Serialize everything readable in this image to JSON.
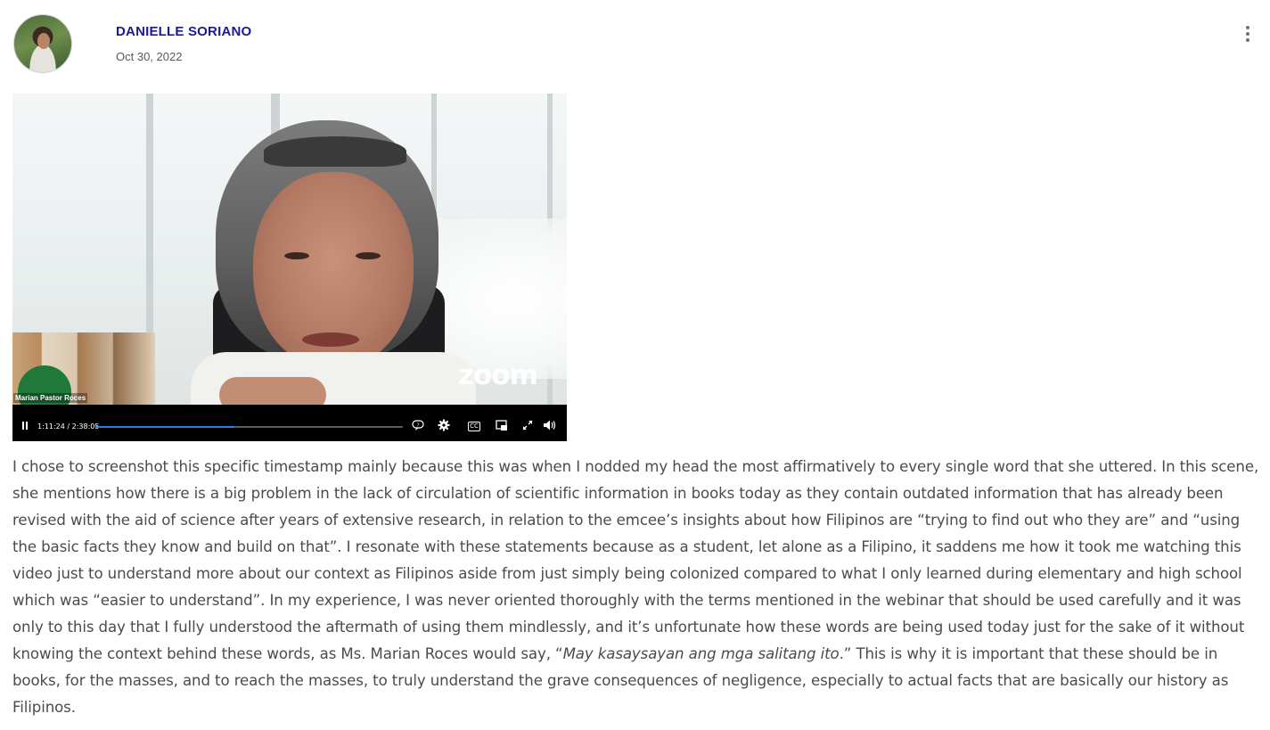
{
  "post": {
    "author": "DANIELLE SORIANO",
    "date": "Oct 30, 2022",
    "menu_icon": "more-vertical-icon"
  },
  "video": {
    "overlay_name": "Marian Pastor Roces",
    "watermark": "zoom",
    "time": "1:11:24 / 2:38:05",
    "progress_fraction": 0.451,
    "icons": [
      "pause-icon",
      "transcript-icon",
      "settings-icon",
      "closed-captions-icon",
      "picture-in-picture-icon",
      "fullscreen-icon",
      "volume-icon"
    ],
    "cc_label": "CC",
    "accent_color": "#2f7de1"
  },
  "body": {
    "part1": "I chose to screenshot this specific timestamp mainly because this was when I nodded my head the most affirmatively to every single word that she uttered. In this scene, she mentions how there is a big problem in the lack of circulation of scientific information in books today as they contain outdated information that has already been revised with the aid of science after years of extensive research, in relation to the emcee’s insights about how Filipinos are “trying to find out who they are” and “using the basic facts they know and build on that”. I resonate with these statements because as a student, let alone as a Filipino, it saddens me how it took me watching this video just to understand more about our context as Filipinos aside from just simply being colonized compared to what I only learned during elementary and high school which was “easier to understand”. In my experience, I was never oriented thoroughly with the terms mentioned in the webinar that should be used carefully and it was only to this day that I fully understood the aftermath of using them mindlessly, and it’s unfortunate how these words are being used today just for the sake of it without knowing the context behind these words, as Ms. Marian Roces would say, “",
    "quote_italic": "May kasaysayan ang mga salitang ito",
    "part2": ".” This is why it is important that these should be in books, for the masses, and to reach the masses, to truly understand the grave consequences of negligence, especially to actual facts that are basically our history as Filipinos."
  }
}
